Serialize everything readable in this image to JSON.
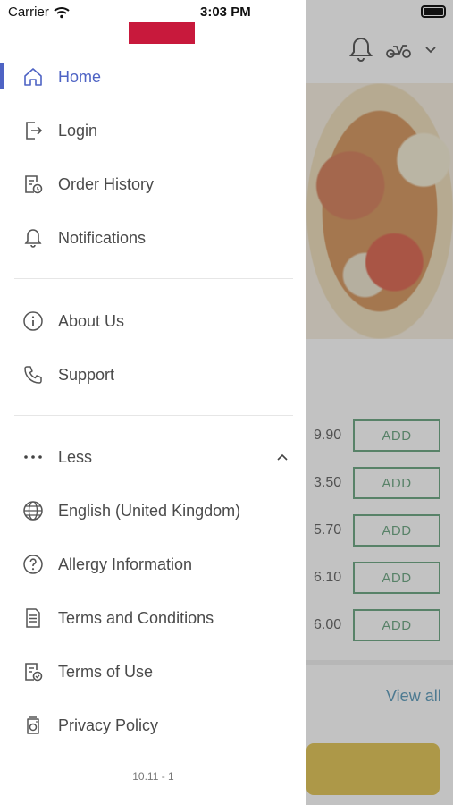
{
  "status_bar": {
    "carrier": "Carrier",
    "time": "3:03 PM"
  },
  "drawer": {
    "primary_items": [
      {
        "label": "Home",
        "icon": "home-icon",
        "active": true
      },
      {
        "label": "Login",
        "icon": "login-icon"
      },
      {
        "label": "Order History",
        "icon": "order-history-icon"
      },
      {
        "label": "Notifications",
        "icon": "bell-icon"
      }
    ],
    "secondary_items": [
      {
        "label": "About Us",
        "icon": "info-icon"
      },
      {
        "label": "Support",
        "icon": "phone-icon"
      }
    ],
    "more_toggle": {
      "label": "Less",
      "icon": "more-dots-icon",
      "chevron": "chevron-up-icon"
    },
    "extra_items": [
      {
        "label": "English (United Kingdom)",
        "icon": "globe-icon"
      },
      {
        "label": "Allergy Information",
        "icon": "question-icon"
      },
      {
        "label": "Terms and Conditions",
        "icon": "document-icon"
      },
      {
        "label": "Terms of Use",
        "icon": "document-check-icon"
      },
      {
        "label": "Privacy Policy",
        "icon": "privacy-icon"
      }
    ],
    "version": "10.11 - 1",
    "accent_color": "#4e63c4",
    "logo_color": "#c8193c"
  },
  "background": {
    "prices": [
      "9.90",
      "3.50",
      "5.70",
      "6.10",
      "6.00"
    ],
    "add_label": "ADD",
    "view_all": "View all"
  }
}
